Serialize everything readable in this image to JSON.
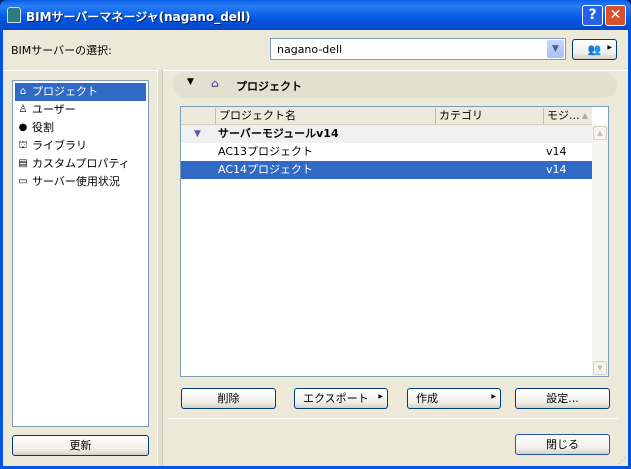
{
  "window": {
    "title": "BIMサーバーマネージャ(nagano_dell)",
    "help": "?",
    "close": "✕"
  },
  "server": {
    "label": "BIMサーバーの選択:",
    "selected": "nagano-dell"
  },
  "sidebar": {
    "items": [
      {
        "label": "プロジェクト",
        "icon": "⌂"
      },
      {
        "label": "ユーザー",
        "icon": "♙"
      },
      {
        "label": "役割",
        "icon": "●"
      },
      {
        "label": "ライブラリ",
        "icon": "⛫"
      },
      {
        "label": "カスタムプロパティ",
        "icon": "▤"
      },
      {
        "label": "サーバー使用状況",
        "icon": "▭"
      }
    ],
    "refresh": "更新"
  },
  "main": {
    "header": "プロジェクト",
    "columns": [
      "プロジェクト名",
      "カテゴリ",
      "モジ..."
    ],
    "group": "サーバーモジュールv14",
    "rows": [
      {
        "name": "AC13プロジェクト",
        "category": "",
        "module": "v14"
      },
      {
        "name": "AC14プロジェクト",
        "category": "",
        "module": "v14"
      }
    ],
    "buttons": {
      "delete": "削除",
      "export": "エクスポート",
      "create": "作成",
      "settings": "設定..."
    },
    "close": "閉じる"
  }
}
